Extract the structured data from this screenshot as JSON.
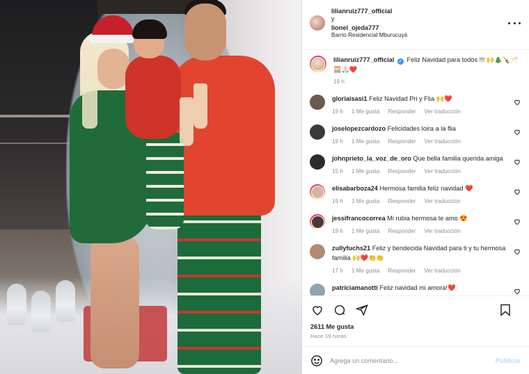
{
  "post": {
    "author_line": "lilianruiz777_official",
    "and_text": "y",
    "coauthor": "lionel_ojeda777",
    "location": "Barrio Residencial Mburucuyá"
  },
  "caption": {
    "username": "lilianruiz777_official",
    "text": "Feliz Navidad para todos !!! 🙌🎄🍾🥂🧮🙏🏻❤️",
    "time": "19 h"
  },
  "comments": [
    {
      "username": "gloriaisasi1",
      "text": "Feliz Navidad Pri y Flia 🙌❤️",
      "time": "19 h",
      "likes": "1 Me gusta",
      "reply": "Responder",
      "translate": "Ver traducción",
      "avatar_color": "#6b5a4e",
      "ring": false
    },
    {
      "username": "joselopezcardozo",
      "text": "Felicidades loira a la flia",
      "time": "19 h",
      "likes": "1 Me gusta",
      "reply": "Responder",
      "translate": "Ver traducción",
      "avatar_color": "#3a3a3a",
      "ring": false
    },
    {
      "username": "johnprieto_la_voz_de_oro",
      "text": "Que bella familia querida amiga",
      "time": "15 h",
      "likes": "1 Me gusta",
      "reply": "Responder",
      "translate": "Ver traducción",
      "avatar_color": "#2b2b2b",
      "ring": false
    },
    {
      "username": "elisabarboza24",
      "text": "Hermosa familia feliz navidad ❤️",
      "time": "19 h",
      "likes": "1 Me gusta",
      "reply": "Responder",
      "translate": "Ver traducción",
      "avatar_color": "#d9b3a3",
      "ring": true
    },
    {
      "username": "jessifrancocorrea",
      "text": "Mi rubia hermosa te amo 😍",
      "time": "19 h",
      "likes": "1 Me gusta",
      "reply": "Responder",
      "translate": "Ver traducción",
      "avatar_color": "#4a3a35",
      "ring": true
    },
    {
      "username": "zullyfuchs21",
      "text": "Feliz y bendecida Navidad para ti y tu hermosa familia 🙌❤️👏👏",
      "time": "17 h",
      "likes": "1 Me gusta",
      "reply": "Responder",
      "translate": "Ver traducción",
      "avatar_color": "#b58a6f",
      "ring": false
    },
    {
      "username": "patriciamanotti",
      "text": "Feliz navidad mi amora!❤️",
      "time": "19 h",
      "likes": "1 Me gusta",
      "reply": "Responder",
      "translate": "Ver traducción",
      "avatar_color": "#8fa3b0",
      "ring": false
    }
  ],
  "likes_count": "2611 Me gusta",
  "posted_ago": "Hace 19 horas",
  "comment_input": {
    "placeholder": "Agrega un comentario...",
    "post_label": "Publicar"
  },
  "colors": {
    "accent": "#0095f6",
    "post_disabled": "#b2dffc",
    "muted": "#8e8e8e",
    "heart": "#ed4956"
  }
}
